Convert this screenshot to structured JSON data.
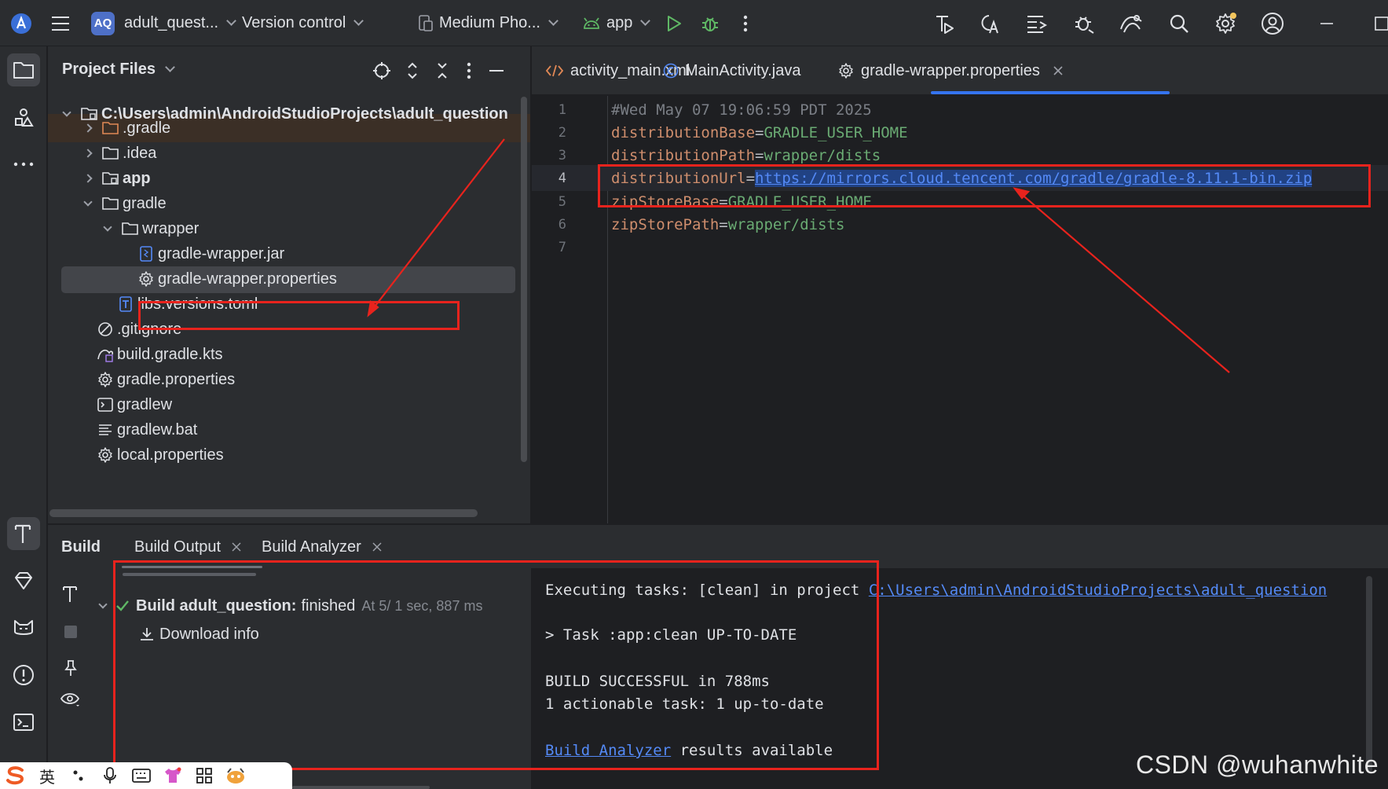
{
  "titlebar": {
    "project_badge": "AQ",
    "project_name": "adult_quest...",
    "vcs": "Version control",
    "device": "Medium Pho...",
    "run_config": "app"
  },
  "project_panel": {
    "title": "Project Files",
    "tree": [
      {
        "label": "C:\\Users\\admin\\AndroidStudioProjects\\adult_question",
        "icon": "folder-module-icon",
        "depth": 0,
        "expanded": true
      },
      {
        "label": ".gradle",
        "icon": "folder-orange-icon",
        "depth": 1,
        "expanded": false
      },
      {
        "label": ".idea",
        "icon": "folder-icon",
        "depth": 1,
        "expanded": false
      },
      {
        "label": "app",
        "icon": "folder-module-icon",
        "depth": 1,
        "expanded": false
      },
      {
        "label": "gradle",
        "icon": "folder-icon",
        "depth": 1,
        "expanded": true
      },
      {
        "label": "wrapper",
        "icon": "folder-icon",
        "depth": 2,
        "expanded": true
      },
      {
        "label": "gradle-wrapper.jar",
        "icon": "jar-icon",
        "depth": 3
      },
      {
        "label": "gradle-wrapper.properties",
        "icon": "gear-icon",
        "depth": 3,
        "selected": true
      },
      {
        "label": "libs.versions.toml",
        "icon": "toml-icon",
        "depth": 2
      },
      {
        "label": ".gitignore",
        "icon": "ignore-icon",
        "depth": 1
      },
      {
        "label": "build.gradle.kts",
        "icon": "gradle-icon",
        "depth": 1
      },
      {
        "label": "gradle.properties",
        "icon": "gear-icon",
        "depth": 1
      },
      {
        "label": "gradlew",
        "icon": "terminal-icon",
        "depth": 1
      },
      {
        "label": "gradlew.bat",
        "icon": "text-lines-icon",
        "depth": 1
      },
      {
        "label": "local.properties",
        "icon": "gear-icon",
        "depth": 1
      }
    ]
  },
  "editor": {
    "tabs": [
      {
        "label": "activity_main.xml",
        "icon": "xml-icon"
      },
      {
        "label": "MainActivity.java",
        "icon": "class-icon"
      },
      {
        "label": "gradle-wrapper.properties",
        "icon": "gear-icon",
        "active": true
      }
    ],
    "lines": [
      {
        "n": "1",
        "comment": "#Wed May 07 19:06:59 PDT 2025"
      },
      {
        "n": "2",
        "key": "distributionBase",
        "eq": "=",
        "value": "GRADLE_USER_HOME"
      },
      {
        "n": "3",
        "key": "distributionPath",
        "eq": "=",
        "value": "wrapper/dists"
      },
      {
        "n": "4",
        "key": "distributionUrl",
        "eq": "=",
        "url": "https://mirrors.cloud.tencent.com/gradle/gradle-8.11.1-bin.zip",
        "current": true
      },
      {
        "n": "5",
        "key": "zipStoreBase",
        "eq": "=",
        "value": "GRADLE_USER_HOME"
      },
      {
        "n": "6",
        "key": "zipStorePath",
        "eq": "=",
        "value": "wrapper/dists"
      },
      {
        "n": "7"
      }
    ]
  },
  "build": {
    "tab_build": "Build",
    "tab_output": "Build Output",
    "tab_analyzer": "Build Analyzer",
    "result_name": "Build adult_question:",
    "result_status": "finished",
    "result_time": "At 5/ 1 sec, 887 ms",
    "download_info": "Download info",
    "console": {
      "line1_prefix": "Executing tasks: [clean] in project ",
      "line1_link": "C:\\Users\\admin\\AndroidStudioProjects\\adult_question",
      "line2": "> Task :app:clean UP-TO-DATE",
      "line3": "BUILD SUCCESSFUL in 788ms",
      "line4": "1 actionable task: 1 up-to-date",
      "line5_link": "Build Analyzer",
      "line5_suffix": " results available"
    }
  },
  "ime": {
    "lang": "英"
  },
  "watermark": "CSDN @wuhanwhite",
  "colors": {
    "accent": "#3574f0",
    "annotation": "#e8231d",
    "success": "#5fb865"
  }
}
